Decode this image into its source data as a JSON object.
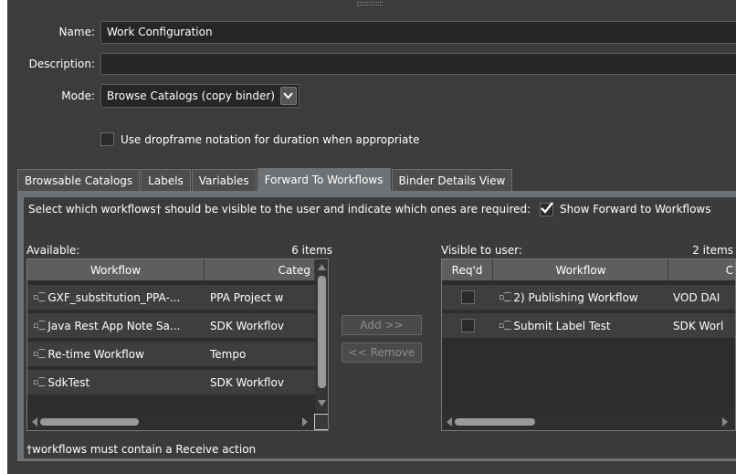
{
  "form": {
    "name_label": "Name:",
    "name_value": "Work Configuration",
    "description_label": "Description:",
    "description_value": "",
    "mode_label": "Mode:",
    "mode_value": "Browse Catalogs (copy binder)",
    "dropframe_label": "Use dropframe notation for duration when appropriate",
    "dropframe_checked": false
  },
  "tabs": [
    {
      "label": "Browsable Catalogs",
      "active": false
    },
    {
      "label": "Labels",
      "active": false
    },
    {
      "label": "Variables",
      "active": false
    },
    {
      "label": "Forward To Workflows",
      "active": true
    },
    {
      "label": "Binder Details View",
      "active": false
    }
  ],
  "forward": {
    "instruction": "Select which workflows† should be visible to the user and indicate which ones are required:",
    "show_forward_label": "Show Forward to Workflows",
    "show_forward_checked": true,
    "available_label": "Available:",
    "available_count": "6 items",
    "visible_label": "Visible to user:",
    "visible_count": "2 items",
    "add_button": "Add >>",
    "remove_button": "<< Remove",
    "footnote": "†workflows must contain a Receive action"
  },
  "available_table": {
    "columns": [
      "Workflow",
      "Categ"
    ],
    "rows": [
      {
        "workflow": "GXF_substitution_PPA-...",
        "category": "PPA Project w"
      },
      {
        "workflow": "Java Rest App Note Sa...",
        "category": "SDK Workflov"
      },
      {
        "workflow": "Re-time Workflow",
        "category": "Tempo"
      },
      {
        "workflow": "SdkTest",
        "category": "SDK Workflov"
      }
    ]
  },
  "visible_table": {
    "columns": [
      "Req'd",
      "Workflow",
      "C"
    ],
    "rows": [
      {
        "required": false,
        "workflow": "2) Publishing Workflow",
        "category": "VOD DAI"
      },
      {
        "required": false,
        "workflow": "Submit Label Test",
        "category": "SDK Worl"
      }
    ]
  },
  "icons": {
    "workflow": "workflow-icon",
    "dropdown": "chevron-down-icon",
    "check": "checkmark-icon"
  }
}
